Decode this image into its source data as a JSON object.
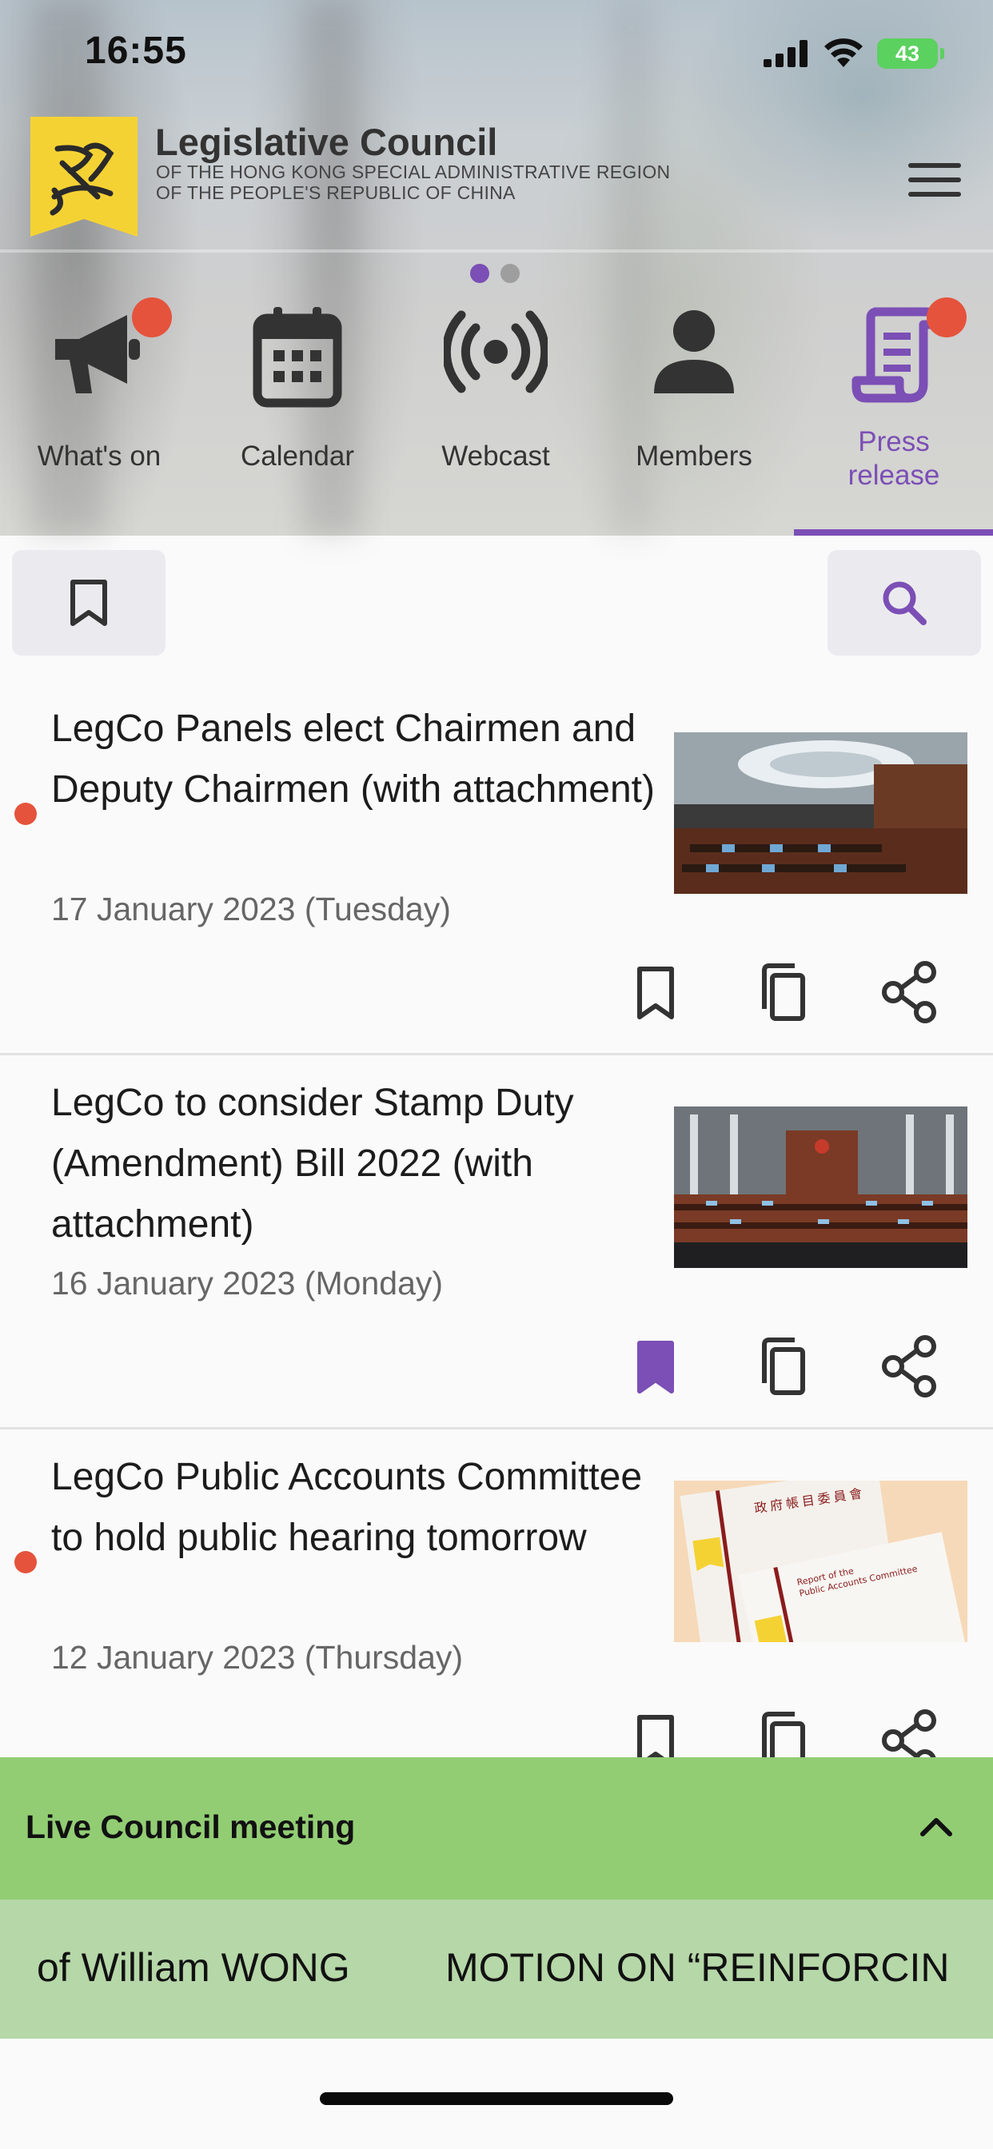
{
  "status_bar": {
    "time": "16:55",
    "battery": "43"
  },
  "header": {
    "title": "Legislative Council",
    "subtitle_line1": "OF THE HONG KONG SPECIAL ADMINISTRATIVE REGION",
    "subtitle_line2": "OF THE PEOPLE'S REPUBLIC OF CHINA",
    "logo_color": "#f5d234"
  },
  "quick_nav": {
    "items": [
      {
        "label": "What's on",
        "icon": "megaphone-icon",
        "badge": true
      },
      {
        "label": "Calendar",
        "icon": "calendar-icon",
        "badge": false
      },
      {
        "label": "Webcast",
        "icon": "broadcast-icon",
        "badge": false
      },
      {
        "label": "Members",
        "icon": "person-icon",
        "badge": false
      },
      {
        "label": "Press\nrelease",
        "icon": "scroll-document-icon",
        "badge": true,
        "active": true
      }
    ],
    "page_indicator": {
      "pages": 2,
      "current": 1
    }
  },
  "toolbar": {
    "left_icon": "bookmark-icon",
    "right_icon": "search-icon"
  },
  "news": [
    {
      "title": "LegCo Panels elect Chairmen and Deputy Chairmen (with attachment)",
      "date": "17 January 2023 (Tuesday)",
      "unread": true,
      "bookmarked": false
    },
    {
      "title": "LegCo to consider Stamp Duty (Amendment) Bill 2022 (with attachment)",
      "date": "16 January 2023 (Monday)",
      "unread": false,
      "bookmarked": true
    },
    {
      "title": "LegCo Public Accounts Committee to hold public hearing tomorrow",
      "date": "12 January 2023 (Thursday)",
      "unread": true,
      "bookmarked": false,
      "thumb_text_cn": "政府帳目委員會",
      "thumb_text_en": "Report of the Public Accounts Committee"
    }
  ],
  "live": {
    "title": "Live Council meeting",
    "ticker_1": "of William WONG",
    "ticker_2": "MOTION ON “REINFORCIN"
  },
  "colors": {
    "accent": "#7b4fb5",
    "badge": "#e5533c",
    "live": "#92cd74",
    "ticker": "#b6d7a8"
  }
}
